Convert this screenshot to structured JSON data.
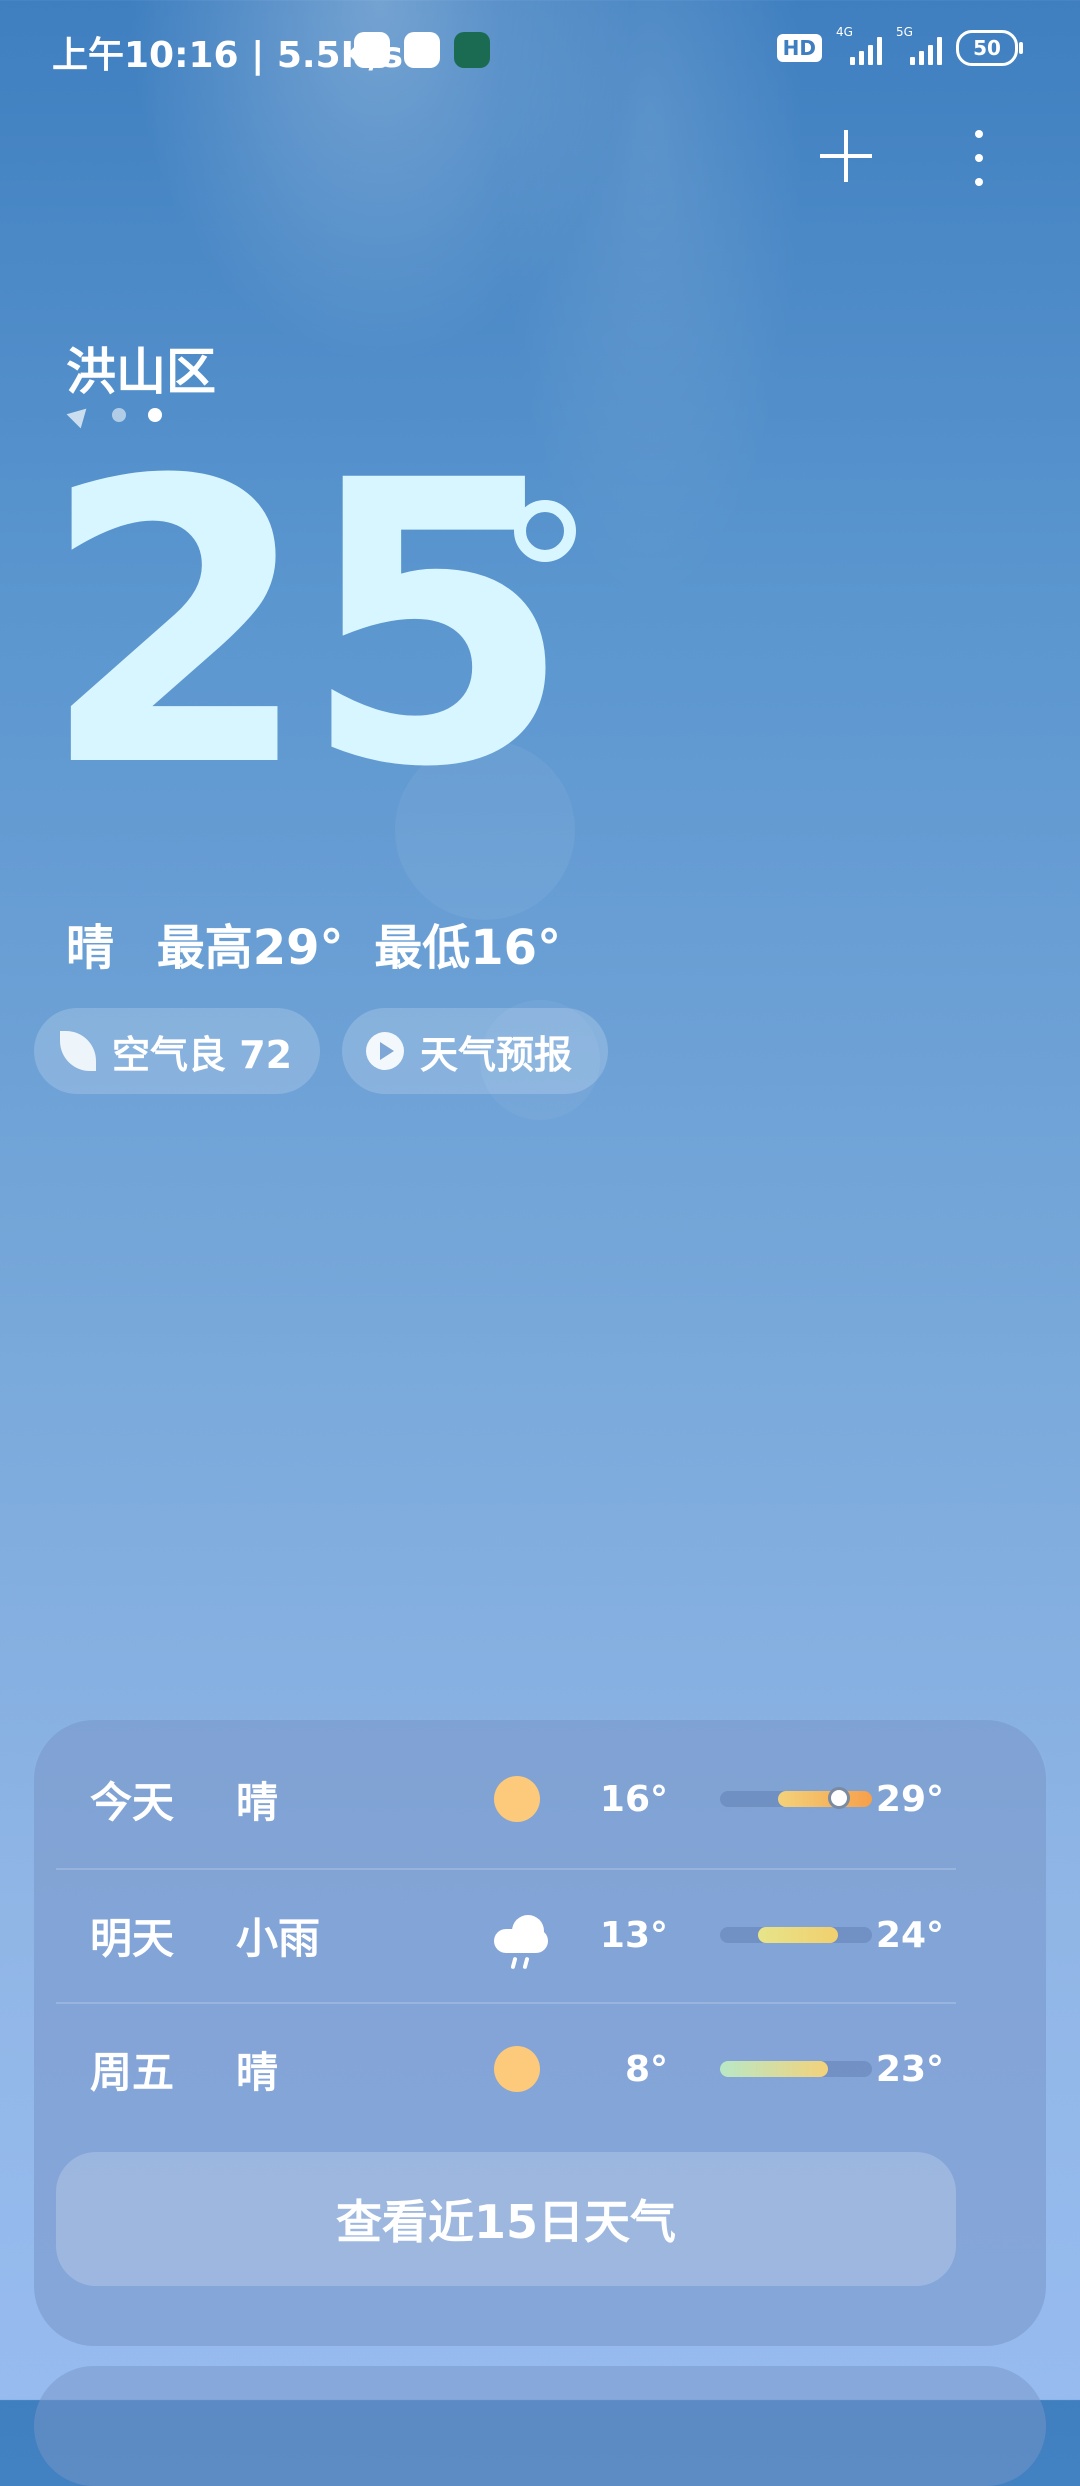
{
  "status_bar": {
    "time": "上午10:16",
    "net_speed": "5.5K/s",
    "hd_badge": "HD",
    "sig1_tag": "4G",
    "sig2_tag": "5G",
    "battery": "50"
  },
  "header": {
    "city": "洪山区"
  },
  "current": {
    "temperature": "25",
    "condition": "晴",
    "high": "最高29°",
    "low": "最低16°"
  },
  "chips": {
    "air": "空气良 72",
    "forecast": "天气预报"
  },
  "forecast": {
    "days": [
      {
        "day": "今天",
        "cond": "晴",
        "icon": "sun-icon",
        "low": "16°",
        "high": "29°"
      },
      {
        "day": "明天",
        "cond": "小雨",
        "icon": "rain-cloud-icon",
        "low": "13°",
        "high": "24°"
      },
      {
        "day": "周五",
        "cond": "晴",
        "icon": "sun-icon",
        "low": "8°",
        "high": "23°"
      }
    ],
    "more_button": "查看近15日天气"
  },
  "colors": {
    "sun": "#fdc97a",
    "temp_text": "#d8f6ff"
  }
}
